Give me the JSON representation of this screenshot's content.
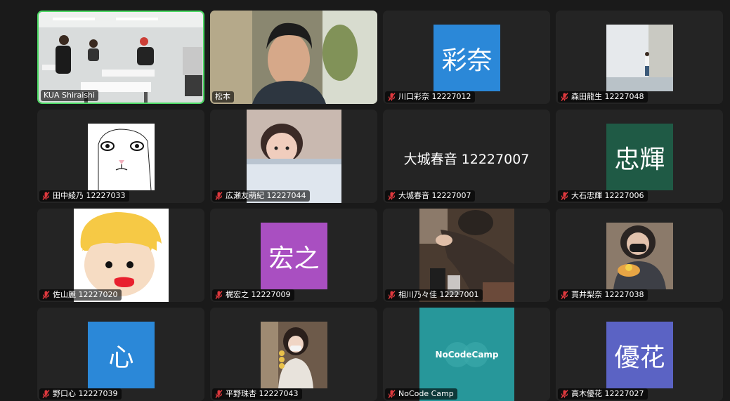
{
  "participants": [
    {
      "name": "KUA Shiraishi",
      "muted": false
    },
    {
      "name": "松本",
      "muted": false
    },
    {
      "name": "川口彩奈 12227012",
      "muted": true,
      "avatar_text": "彩奈",
      "avatar_color": "#2b88d8"
    },
    {
      "name": "森田龍生 12227048",
      "muted": true
    },
    {
      "name": "田中綾乃 12227033",
      "muted": true
    },
    {
      "name": "広瀬友萌紀 12227044",
      "muted": true
    },
    {
      "name": "大城春音 12227007",
      "muted": true,
      "center_text": "大城春音 12227007"
    },
    {
      "name": "大石忠輝 12227006",
      "muted": true,
      "avatar_text": "忠輝",
      "avatar_color": "#1f5a45"
    },
    {
      "name": "佐山麗 12227020",
      "muted": true
    },
    {
      "name": "梶宏之 12227009",
      "muted": true,
      "avatar_text": "宏之",
      "avatar_color": "#a94fc1"
    },
    {
      "name": "相川乃々佳 12227001",
      "muted": true
    },
    {
      "name": "貫井梨奈 12227038",
      "muted": true
    },
    {
      "name": "野口心 12227039",
      "muted": true,
      "avatar_text": "心",
      "avatar_color": "#2b88d8"
    },
    {
      "name": "平野珠杏 12227043",
      "muted": true
    },
    {
      "name": "NoCode Camp",
      "muted": true,
      "avatar_text": "NoCodeCamp",
      "avatar_color": "#27979a"
    },
    {
      "name": "高木優花 12227027",
      "muted": true,
      "avatar_text": "優花",
      "avatar_color": "#5b63c4"
    }
  ],
  "colors": {
    "active_speaker_border": "#4cd964",
    "mute_icon": "#e0393e",
    "tile_bg": "#242424"
  }
}
